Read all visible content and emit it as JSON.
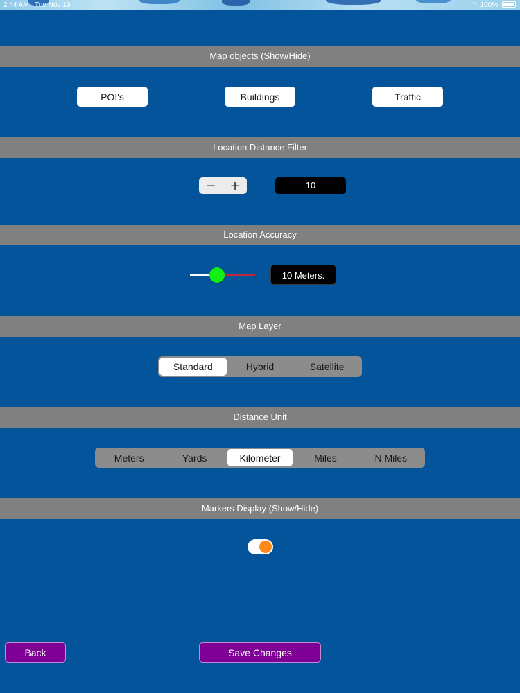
{
  "status_bar": {
    "time": "2:44 AM",
    "date": "Tue Nov 19",
    "battery": "100%"
  },
  "sections": {
    "map_objects": "Map objects (Show/Hide)",
    "distance_filter": "Location Distance Filter",
    "accuracy": "Location Accuracy",
    "map_layer": "Map Layer",
    "distance_unit": "Distance Unit",
    "markers_display": "Markers Display (Show/Hide)"
  },
  "map_objects": {
    "pois": "POI's",
    "buildings": "Buildings",
    "traffic": "Traffic"
  },
  "distance_filter": {
    "minus": "−",
    "plus": "+",
    "value": "10"
  },
  "accuracy": {
    "value_label": "10 Meters.",
    "slider_fraction": 0.42
  },
  "map_layer": {
    "options": [
      "Standard",
      "Hybrid",
      "Satellite"
    ],
    "selected": "Standard"
  },
  "distance_unit": {
    "options": [
      "Meters",
      "Yards",
      "Kilometer",
      "Miles",
      "N Miles"
    ],
    "selected": "Kilometer"
  },
  "markers_display": {
    "on": true
  },
  "footer": {
    "back": "Back",
    "save": "Save Changes"
  },
  "colors": {
    "background": "#03549b",
    "header": "#808080",
    "accent_purple": "#7f0095",
    "slider_thumb": "#13ee13",
    "toggle_knob": "#ff8a1a"
  }
}
